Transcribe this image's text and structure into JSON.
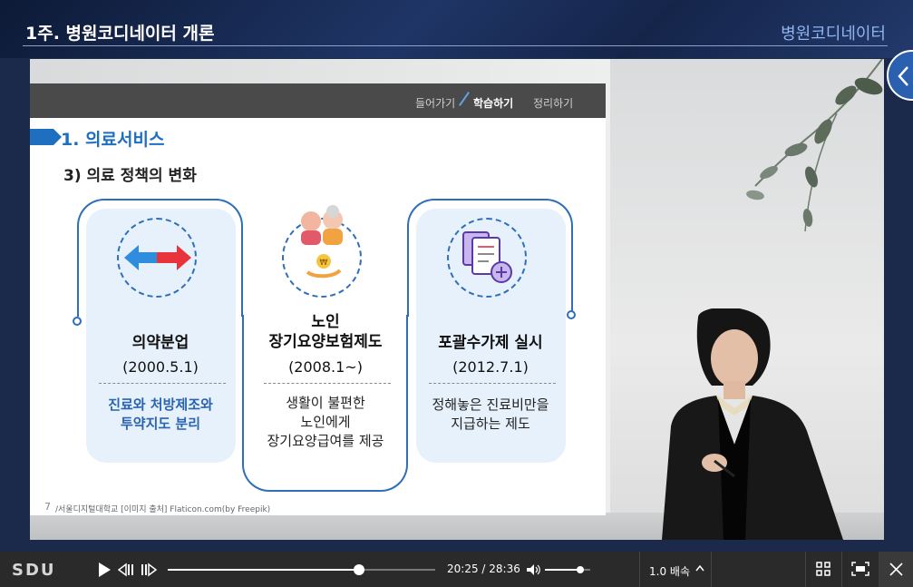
{
  "header": {
    "course_title": "1주.  병원코디네이터 개론",
    "brand": "병원코디네이터"
  },
  "slide": {
    "nav": [
      "들어가기",
      "학습하기",
      "정리하기"
    ],
    "section_title": "1. 의료서비스",
    "sub_title": "3) 의료 정책의 변화",
    "cards": [
      {
        "title": "의약분업",
        "date": "(2000.5.1)",
        "desc": [
          "진료와 처방제조와",
          "투약지도 분리"
        ]
      },
      {
        "title": "노인\n장기요양보험제도",
        "title1": "노인",
        "title2": "장기요양보험제도",
        "date": "(2008.1~)",
        "desc": [
          "생활이 불편한",
          "노인에게",
          "장기요양급여를 제공"
        ]
      },
      {
        "title": "포괄수가제 실시",
        "date": "(2012.7.1)",
        "desc": [
          "정해놓은 진료비만을",
          "지급하는 제도"
        ]
      }
    ],
    "page_number": "7",
    "footer": "/서울디지털대학교   [이미지 출처] Flaticon.com(by Freepik)"
  },
  "player": {
    "logo": "SDU",
    "current_time": "20:25",
    "total_time": "28:36",
    "time_display": "20:25 / 28:36",
    "progress_fraction": 0.715,
    "volume_fraction": 0.78,
    "speed_label": "1.0 배속"
  },
  "colors": {
    "accent_blue": "#2e6fb7",
    "section_blue": "#1f6fc0",
    "card_bg": "#e7f1fb",
    "control_bar": "#2a2a2a"
  }
}
